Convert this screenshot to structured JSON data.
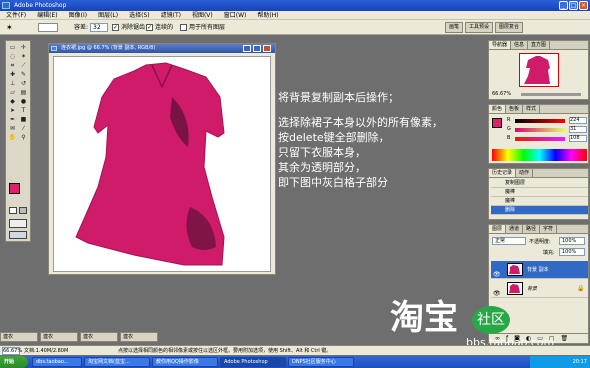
{
  "window": {
    "title": "Adobe Photoshop",
    "controls": [
      "_",
      "□",
      "×"
    ]
  },
  "menu": [
    "文件(F)",
    "编辑(E)",
    "图像(I)",
    "图层(L)",
    "选择(S)",
    "滤镜(T)",
    "视图(V)",
    "窗口(W)",
    "帮助(H)"
  ],
  "options": {
    "tolerance_label": "容差:",
    "tolerance_value": "32",
    "antialias_label": "消除锯齿",
    "contiguous_label": "连续的",
    "all_layers_label": "用于所有图层"
  },
  "palette_well": [
    "画笔",
    "工具预设",
    "图层复合"
  ],
  "document": {
    "title": "连衣裙.jpg @ 66.7% (背景 副本, RGB/8)"
  },
  "instructions": [
    "将背景复制副本后操作；",
    "",
    "选择除裙子本身以外的所有像素，",
    "按delete键全部删除，",
    "只留下衣服本身，",
    "其余为透明部分，",
    "即下图中灰白格子部分"
  ],
  "navigator": {
    "tabs": [
      "导航器",
      "信息",
      "直方图"
    ],
    "zoom": "66.67%"
  },
  "color": {
    "tabs": [
      "颜色",
      "色板",
      "样式"
    ],
    "R": "224",
    "G": "31",
    "B": "108",
    "fg": "#e01f6c"
  },
  "history": {
    "tabs": [
      "历史记录",
      "动作"
    ],
    "items": [
      "复制图层",
      "魔棒",
      "魔棒",
      "删除"
    ]
  },
  "layers": {
    "tabs": [
      "图层",
      "通道",
      "路径",
      "字符"
    ],
    "blend": "正常",
    "opacity_label": "不透明度:",
    "opacity": "100%",
    "fill_label": "填充:",
    "fill": "100%",
    "items": [
      {
        "name": "背景 副本"
      },
      {
        "name": "背景"
      }
    ]
  },
  "status": {
    "zoom": "66.67%",
    "doc": "文档:1.40M/2.80M",
    "hint": "点按以选择相同颜色的相邻像素或按住以选区外框。要用附加选项，使用 Shift、Alt 和 Ctrl 键。"
  },
  "minimized": [
    "連衣",
    "連衣",
    "連衣",
    "連衣"
  ],
  "taskbar": {
    "start": "开始",
    "tasks": [
      "dbs.taobao...",
      "淘宝网文档(蓝宝...",
      "教你用QQ操作影像",
      "Adobe Photoshop",
      "DNPS社区服务中心"
    ],
    "time": "20:17"
  },
  "watermark": {
    "brand": "淘宝",
    "site": "bbs.taobao.com",
    "tag": "社区"
  }
}
